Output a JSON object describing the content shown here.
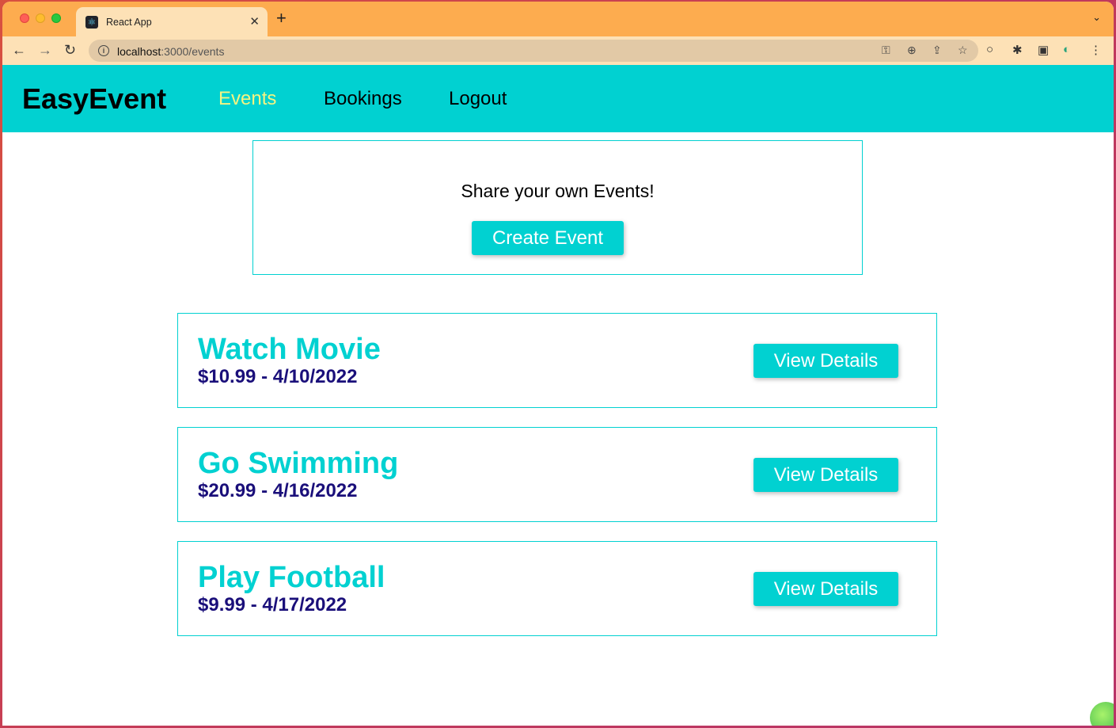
{
  "browser": {
    "tab": {
      "title": "React App",
      "favicon": "react-icon",
      "close_glyph": "✕"
    },
    "new_tab_glyph": "+",
    "tab_menu_glyph": "⌄",
    "url_host": "localhost",
    "url_path": ":3000/events",
    "icons": {
      "back": "←",
      "forward": "→",
      "reload": "↻",
      "info": "i",
      "key": "⚿",
      "zoom": "⊕",
      "share": "⇪",
      "star": "☆",
      "extension_circle": "○",
      "puzzle": "✱",
      "sidebar": "▣",
      "profile": "◐",
      "menu": "⋮"
    }
  },
  "navbar": {
    "brand": "EasyEvent",
    "links": [
      {
        "label": "Events",
        "active": true
      },
      {
        "label": "Bookings",
        "active": false
      },
      {
        "label": "Logout",
        "active": false
      }
    ]
  },
  "create_section": {
    "text": "Share your own Events!",
    "button_label": "Create Event"
  },
  "events": [
    {
      "title": "Watch Movie",
      "meta": "$10.99 - 4/10/2022",
      "button_label": "View Details"
    },
    {
      "title": "Go Swimming",
      "meta": "$20.99 - 4/16/2022",
      "button_label": "View Details"
    },
    {
      "title": "Play Football",
      "meta": "$9.99 - 4/17/2022",
      "button_label": "View Details"
    }
  ],
  "colors": {
    "accent": "#01d1d1",
    "active_link": "#f5f481",
    "meta_text": "#1a0f7a",
    "tab_strip": "#fdac4f",
    "toolbar": "#fde1b6"
  }
}
